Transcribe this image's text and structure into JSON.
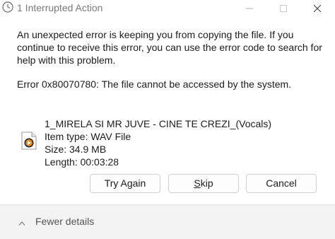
{
  "window": {
    "title": "1 Interrupted Action",
    "title_icon": "clock-icon"
  },
  "dialog": {
    "message": "An unexpected error is keeping you from copying the file. If you continue to receive this error, you can use the error code to search for help with this problem.",
    "error": "Error 0x80070780: The file cannot be accessed by the system."
  },
  "file": {
    "icon": "audio-file-icon",
    "name": "1_MIRELA SI MR JUVE - CINE TE CREZI_(Vocals)",
    "type": "Item type: WAV File",
    "size": "Size: 34.9 MB",
    "length": "Length: 00:03:28"
  },
  "buttons": {
    "try_again": "Try Again",
    "skip_mnemonic": "S",
    "skip_rest": "kip",
    "cancel": "Cancel"
  },
  "footer": {
    "fewer_details": "Fewer details"
  },
  "colors": {
    "footer_bg": "#f3f3f3",
    "title_text": "#7a7a7a"
  }
}
